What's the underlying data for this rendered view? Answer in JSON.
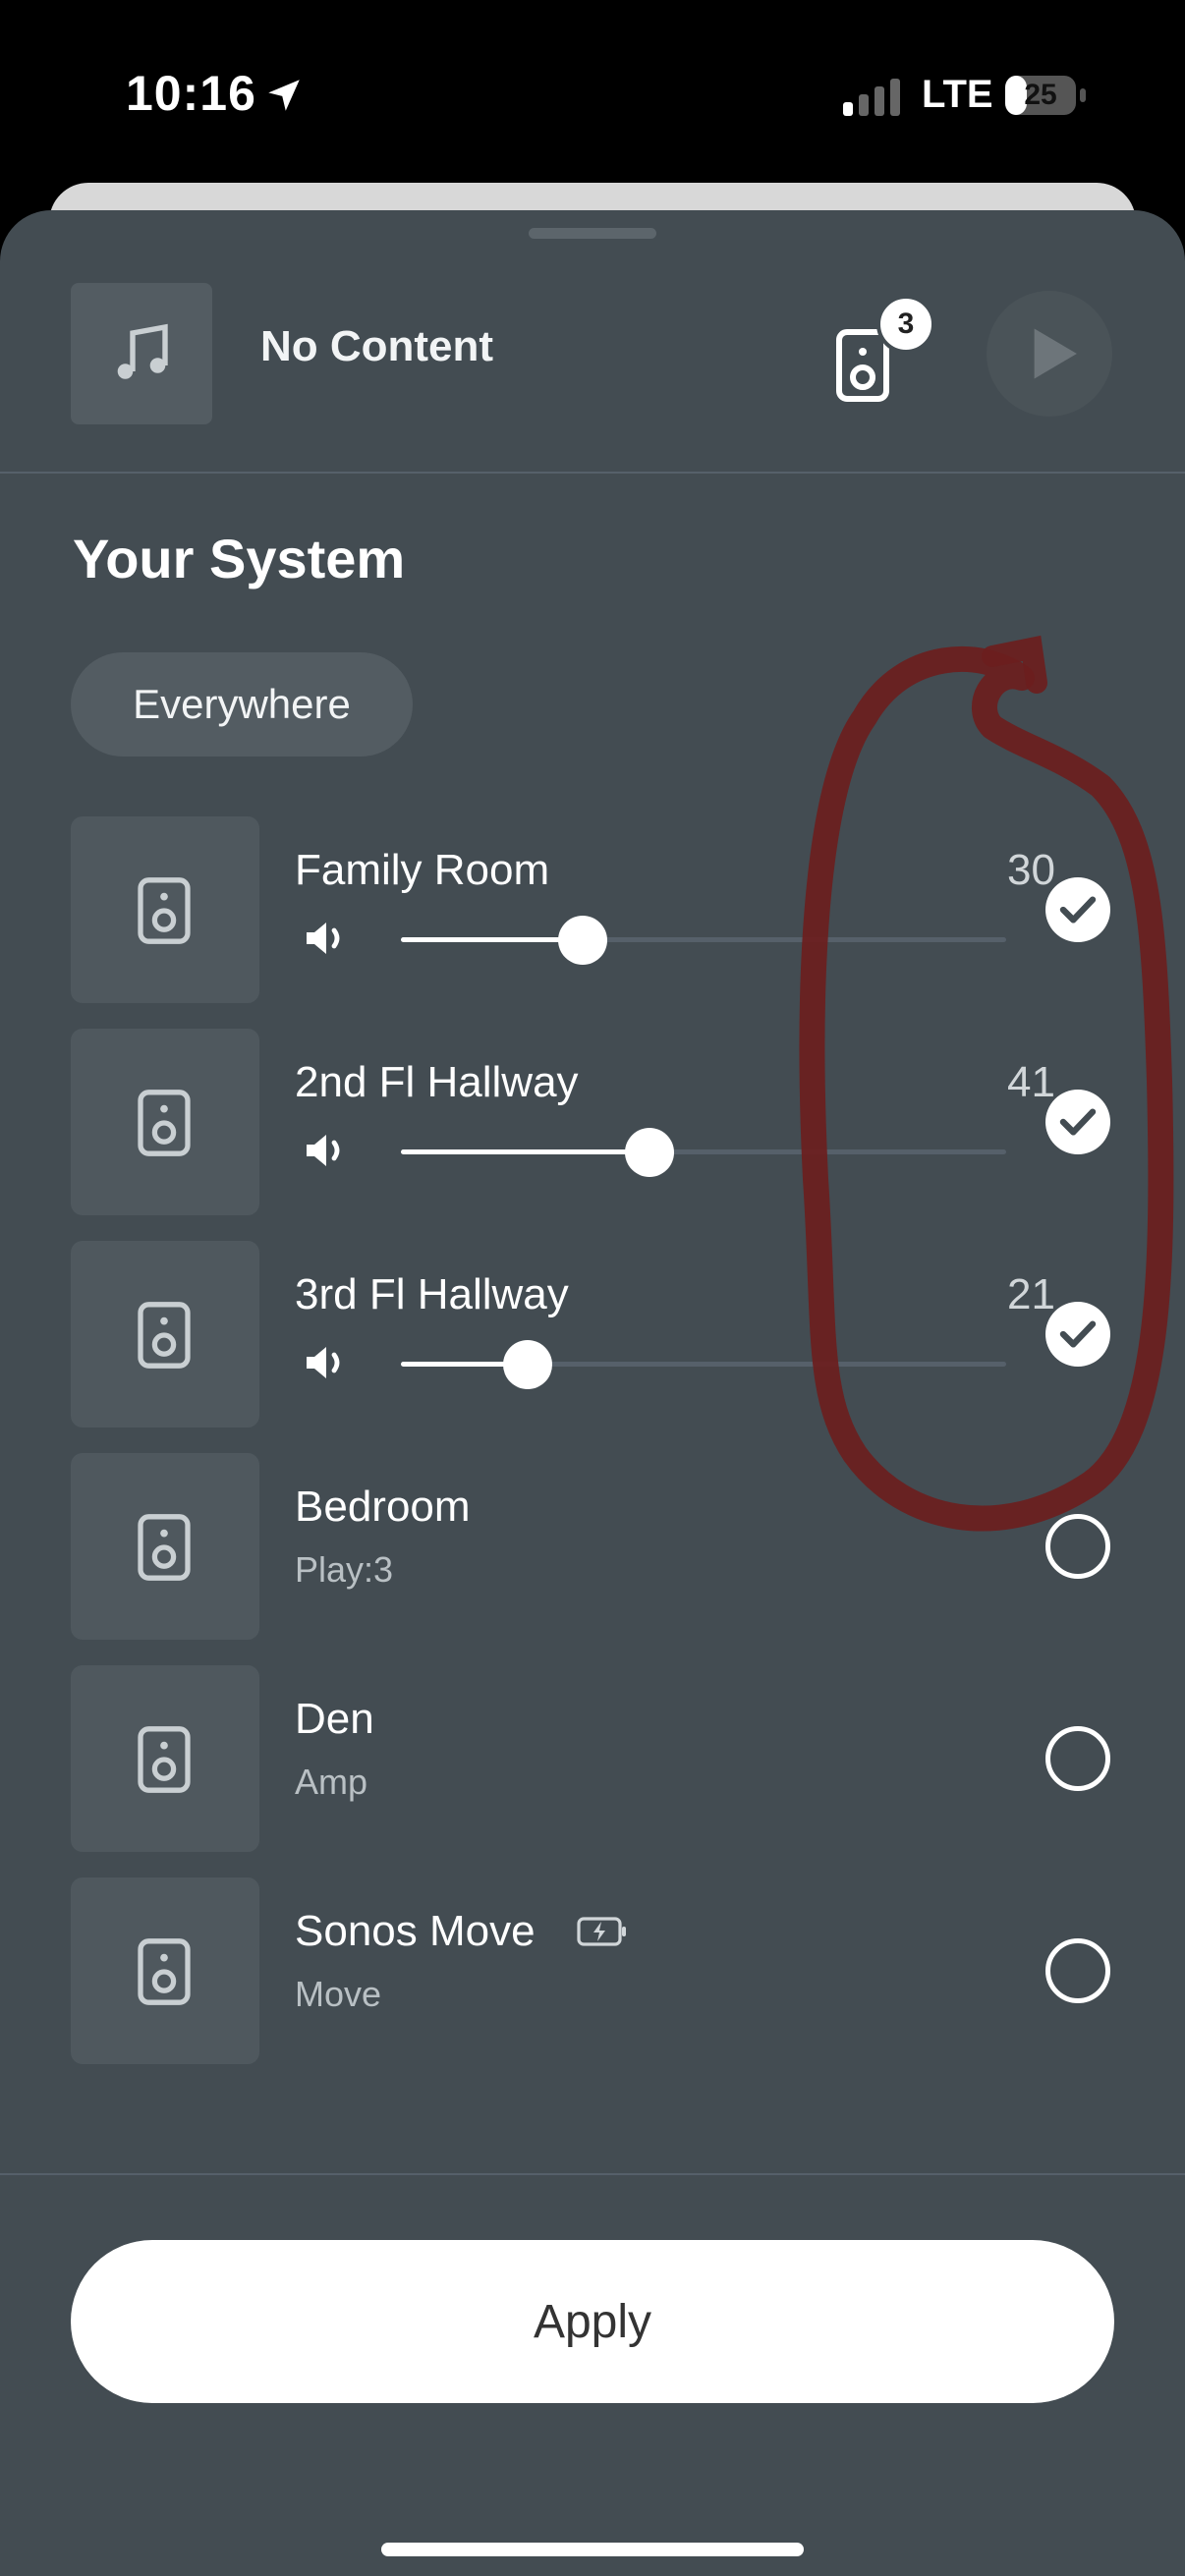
{
  "status_bar": {
    "time": "10:16",
    "network": "LTE",
    "battery": "25"
  },
  "now_playing": {
    "title": "No Content",
    "group_count": "3"
  },
  "system": {
    "title": "Your System",
    "chip_label": "Everywhere"
  },
  "rooms": [
    {
      "name": "Family Room",
      "volume": "30",
      "level": 0.3,
      "selected": true
    },
    {
      "name": "2nd Fl Hallway",
      "volume": "41",
      "level": 0.41,
      "selected": true
    },
    {
      "name": "3rd Fl Hallway",
      "volume": "21",
      "level": 0.21,
      "selected": true
    },
    {
      "name": "Bedroom",
      "subtitle": "Play:3",
      "selected": false
    },
    {
      "name": "Den",
      "subtitle": "Amp",
      "selected": false
    },
    {
      "name": "Sonos Move",
      "subtitle": "Move",
      "selected": false,
      "charging": true
    }
  ],
  "apply_label": "Apply",
  "colors": {
    "sheet": "#434c52",
    "annotation": "#6b1e1e"
  }
}
